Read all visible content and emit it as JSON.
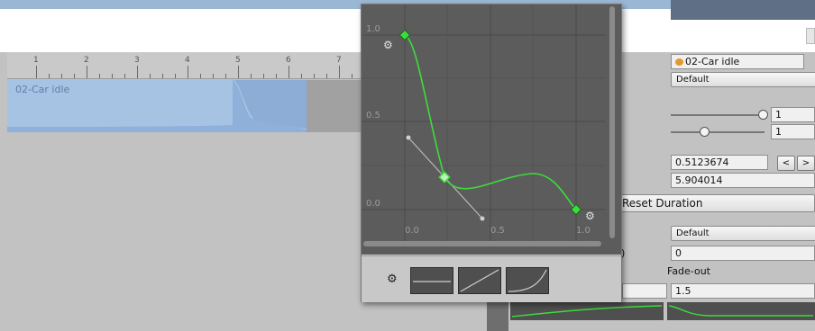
{
  "timeline": {
    "ruler_ticks": [
      "1",
      "2",
      "3",
      "4",
      "5",
      "6",
      "7"
    ],
    "clip_name": "02-Car idle"
  },
  "curve_editor": {
    "y_labels": [
      "1.0",
      "0.5",
      "0.0"
    ],
    "x_labels": [
      "0.0",
      "0.5",
      "1.0"
    ],
    "curve_color": "#3cdc3c",
    "key_icon": "gear-key-icon",
    "presets": [
      "flat-preset",
      "linear-preset",
      "ease-in-preset"
    ]
  },
  "inspector": {
    "clip_field": "02-Car idle",
    "blend_dropdown": "Default",
    "slider1_value": "1",
    "slider2_value": "1",
    "value_a": "0.5123674",
    "value_b": "5.904014",
    "prev_label": "<",
    "next_label": ">",
    "reset_duration_label": "Reset Duration",
    "ease_dropdown": "Default",
    "ease_value": "0",
    "fade_out_label": "Fade-out",
    "fade_out_value": "1.5",
    "paren_text": ")"
  }
}
